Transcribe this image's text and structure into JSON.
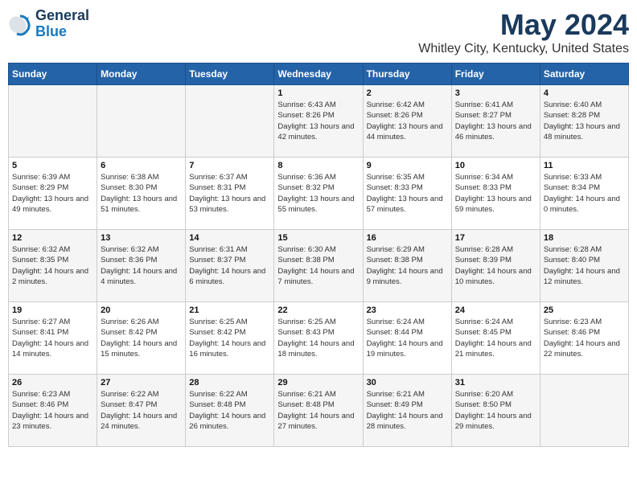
{
  "header": {
    "logo_line1": "General",
    "logo_line2": "Blue",
    "main_title": "May 2024",
    "subtitle": "Whitley City, Kentucky, United States"
  },
  "days_of_week": [
    "Sunday",
    "Monday",
    "Tuesday",
    "Wednesday",
    "Thursday",
    "Friday",
    "Saturday"
  ],
  "weeks": [
    [
      {
        "day": "",
        "sunrise": "",
        "sunset": "",
        "daylight": ""
      },
      {
        "day": "",
        "sunrise": "",
        "sunset": "",
        "daylight": ""
      },
      {
        "day": "",
        "sunrise": "",
        "sunset": "",
        "daylight": ""
      },
      {
        "day": "1",
        "sunrise": "Sunrise: 6:43 AM",
        "sunset": "Sunset: 8:26 PM",
        "daylight": "Daylight: 13 hours and 42 minutes."
      },
      {
        "day": "2",
        "sunrise": "Sunrise: 6:42 AM",
        "sunset": "Sunset: 8:26 PM",
        "daylight": "Daylight: 13 hours and 44 minutes."
      },
      {
        "day": "3",
        "sunrise": "Sunrise: 6:41 AM",
        "sunset": "Sunset: 8:27 PM",
        "daylight": "Daylight: 13 hours and 46 minutes."
      },
      {
        "day": "4",
        "sunrise": "Sunrise: 6:40 AM",
        "sunset": "Sunset: 8:28 PM",
        "daylight": "Daylight: 13 hours and 48 minutes."
      }
    ],
    [
      {
        "day": "5",
        "sunrise": "Sunrise: 6:39 AM",
        "sunset": "Sunset: 8:29 PM",
        "daylight": "Daylight: 13 hours and 49 minutes."
      },
      {
        "day": "6",
        "sunrise": "Sunrise: 6:38 AM",
        "sunset": "Sunset: 8:30 PM",
        "daylight": "Daylight: 13 hours and 51 minutes."
      },
      {
        "day": "7",
        "sunrise": "Sunrise: 6:37 AM",
        "sunset": "Sunset: 8:31 PM",
        "daylight": "Daylight: 13 hours and 53 minutes."
      },
      {
        "day": "8",
        "sunrise": "Sunrise: 6:36 AM",
        "sunset": "Sunset: 8:32 PM",
        "daylight": "Daylight: 13 hours and 55 minutes."
      },
      {
        "day": "9",
        "sunrise": "Sunrise: 6:35 AM",
        "sunset": "Sunset: 8:33 PM",
        "daylight": "Daylight: 13 hours and 57 minutes."
      },
      {
        "day": "10",
        "sunrise": "Sunrise: 6:34 AM",
        "sunset": "Sunset: 8:33 PM",
        "daylight": "Daylight: 13 hours and 59 minutes."
      },
      {
        "day": "11",
        "sunrise": "Sunrise: 6:33 AM",
        "sunset": "Sunset: 8:34 PM",
        "daylight": "Daylight: 14 hours and 0 minutes."
      }
    ],
    [
      {
        "day": "12",
        "sunrise": "Sunrise: 6:32 AM",
        "sunset": "Sunset: 8:35 PM",
        "daylight": "Daylight: 14 hours and 2 minutes."
      },
      {
        "day": "13",
        "sunrise": "Sunrise: 6:32 AM",
        "sunset": "Sunset: 8:36 PM",
        "daylight": "Daylight: 14 hours and 4 minutes."
      },
      {
        "day": "14",
        "sunrise": "Sunrise: 6:31 AM",
        "sunset": "Sunset: 8:37 PM",
        "daylight": "Daylight: 14 hours and 6 minutes."
      },
      {
        "day": "15",
        "sunrise": "Sunrise: 6:30 AM",
        "sunset": "Sunset: 8:38 PM",
        "daylight": "Daylight: 14 hours and 7 minutes."
      },
      {
        "day": "16",
        "sunrise": "Sunrise: 6:29 AM",
        "sunset": "Sunset: 8:38 PM",
        "daylight": "Daylight: 14 hours and 9 minutes."
      },
      {
        "day": "17",
        "sunrise": "Sunrise: 6:28 AM",
        "sunset": "Sunset: 8:39 PM",
        "daylight": "Daylight: 14 hours and 10 minutes."
      },
      {
        "day": "18",
        "sunrise": "Sunrise: 6:28 AM",
        "sunset": "Sunset: 8:40 PM",
        "daylight": "Daylight: 14 hours and 12 minutes."
      }
    ],
    [
      {
        "day": "19",
        "sunrise": "Sunrise: 6:27 AM",
        "sunset": "Sunset: 8:41 PM",
        "daylight": "Daylight: 14 hours and 14 minutes."
      },
      {
        "day": "20",
        "sunrise": "Sunrise: 6:26 AM",
        "sunset": "Sunset: 8:42 PM",
        "daylight": "Daylight: 14 hours and 15 minutes."
      },
      {
        "day": "21",
        "sunrise": "Sunrise: 6:25 AM",
        "sunset": "Sunset: 8:42 PM",
        "daylight": "Daylight: 14 hours and 16 minutes."
      },
      {
        "day": "22",
        "sunrise": "Sunrise: 6:25 AM",
        "sunset": "Sunset: 8:43 PM",
        "daylight": "Daylight: 14 hours and 18 minutes."
      },
      {
        "day": "23",
        "sunrise": "Sunrise: 6:24 AM",
        "sunset": "Sunset: 8:44 PM",
        "daylight": "Daylight: 14 hours and 19 minutes."
      },
      {
        "day": "24",
        "sunrise": "Sunrise: 6:24 AM",
        "sunset": "Sunset: 8:45 PM",
        "daylight": "Daylight: 14 hours and 21 minutes."
      },
      {
        "day": "25",
        "sunrise": "Sunrise: 6:23 AM",
        "sunset": "Sunset: 8:46 PM",
        "daylight": "Daylight: 14 hours and 22 minutes."
      }
    ],
    [
      {
        "day": "26",
        "sunrise": "Sunrise: 6:23 AM",
        "sunset": "Sunset: 8:46 PM",
        "daylight": "Daylight: 14 hours and 23 minutes."
      },
      {
        "day": "27",
        "sunrise": "Sunrise: 6:22 AM",
        "sunset": "Sunset: 8:47 PM",
        "daylight": "Daylight: 14 hours and 24 minutes."
      },
      {
        "day": "28",
        "sunrise": "Sunrise: 6:22 AM",
        "sunset": "Sunset: 8:48 PM",
        "daylight": "Daylight: 14 hours and 26 minutes."
      },
      {
        "day": "29",
        "sunrise": "Sunrise: 6:21 AM",
        "sunset": "Sunset: 8:48 PM",
        "daylight": "Daylight: 14 hours and 27 minutes."
      },
      {
        "day": "30",
        "sunrise": "Sunrise: 6:21 AM",
        "sunset": "Sunset: 8:49 PM",
        "daylight": "Daylight: 14 hours and 28 minutes."
      },
      {
        "day": "31",
        "sunrise": "Sunrise: 6:20 AM",
        "sunset": "Sunset: 8:50 PM",
        "daylight": "Daylight: 14 hours and 29 minutes."
      },
      {
        "day": "",
        "sunrise": "",
        "sunset": "",
        "daylight": ""
      }
    ]
  ]
}
